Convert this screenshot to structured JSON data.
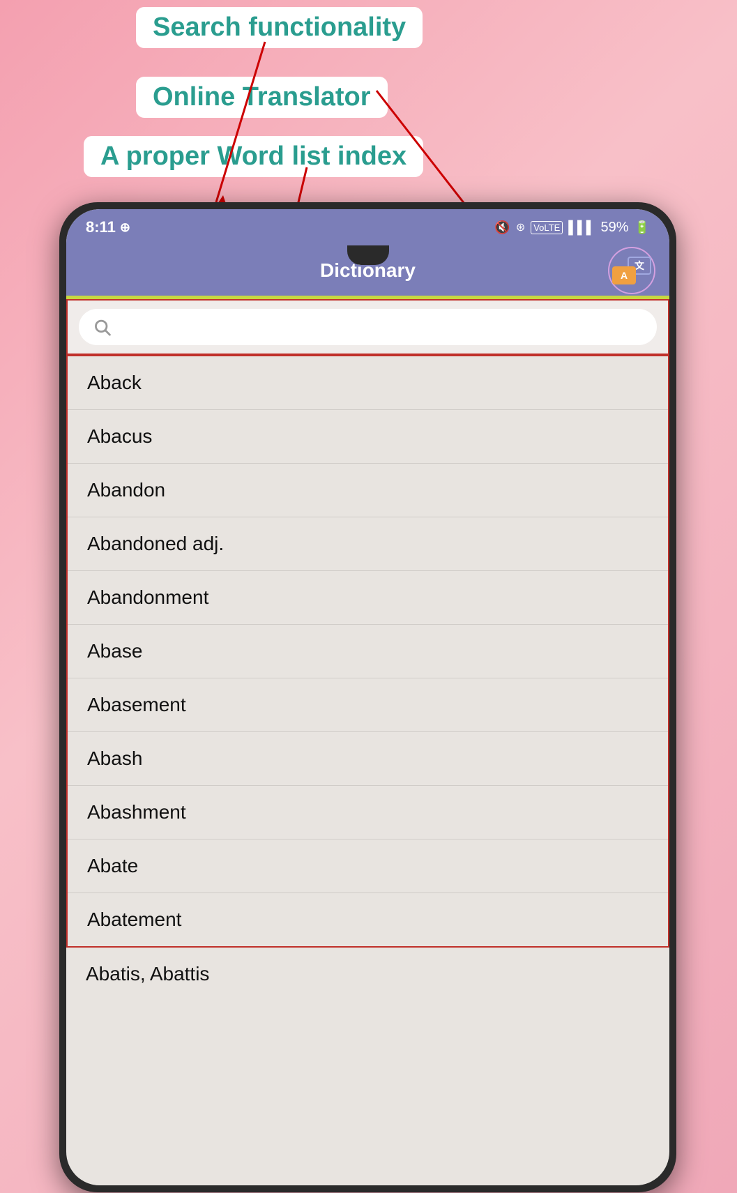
{
  "annotations": {
    "label1": "Search functionality",
    "label2": "Online Translator",
    "label3": "A proper Word list index"
  },
  "status_bar": {
    "time": "8:11",
    "whatsapp_icon": "⊙",
    "battery": "59%"
  },
  "app": {
    "title": "Dictionary",
    "translate_label_top": "文",
    "translate_label_bottom": "A"
  },
  "search": {
    "placeholder": ""
  },
  "word_list": [
    "Aback",
    "Abacus",
    "Abandon",
    "Abandoned adj.",
    "Abandonment",
    "Abase",
    "Abasement",
    "Abash",
    "Abashment",
    "Abate",
    "Abatement"
  ],
  "partial_word": "Abatis, Abattis"
}
